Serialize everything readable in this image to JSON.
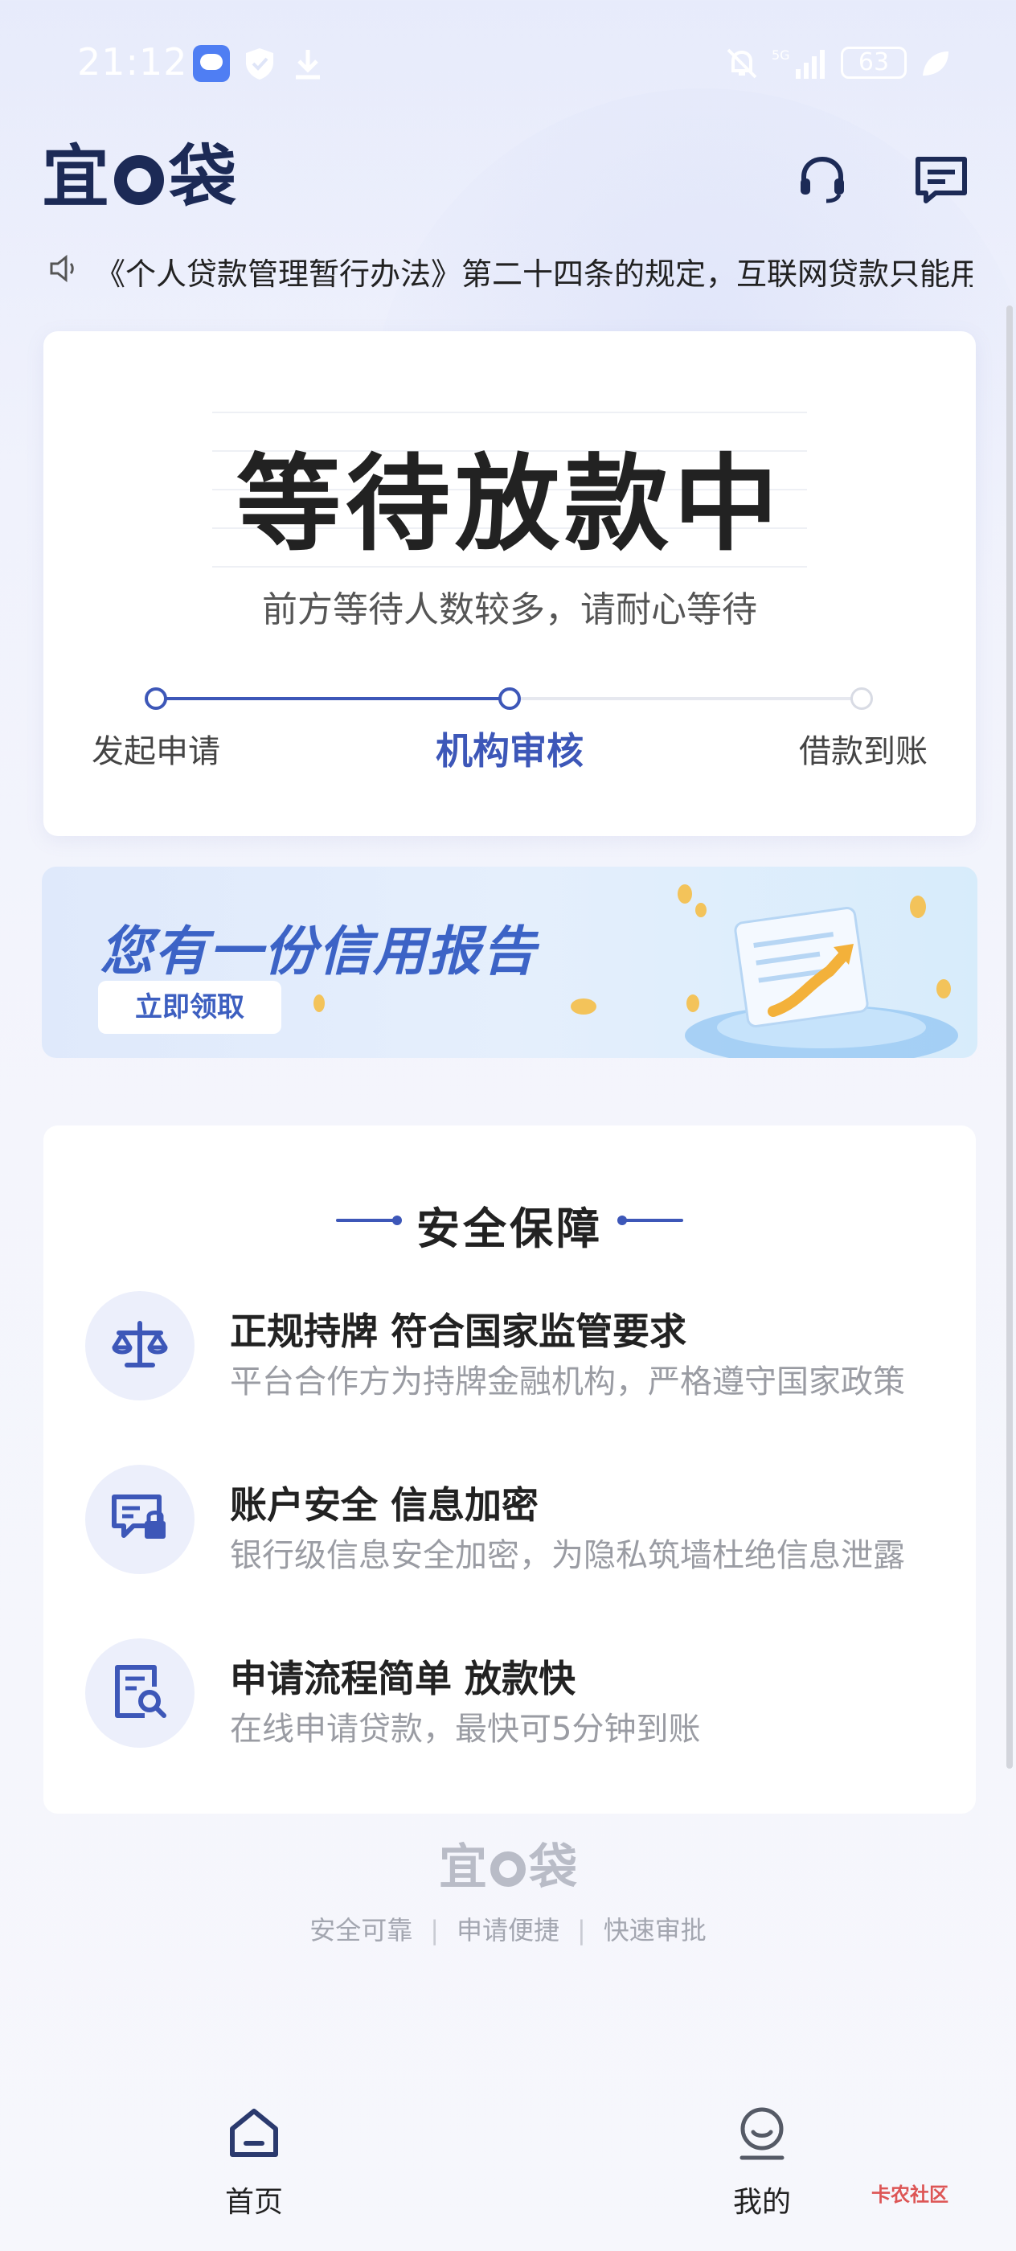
{
  "status_bar": {
    "time": "21:12",
    "battery": "63"
  },
  "header": {
    "logo_part1": "宜",
    "logo_part2": "袋",
    "service_icon": "headset-icon",
    "message_icon": "message-icon"
  },
  "notice": {
    "icon": "speaker-icon",
    "text": "《个人贷款管理暂行办法》第二十四条的规定，互联网贷款只能用于"
  },
  "status_card": {
    "title": "等待放款中",
    "subtitle": "前方等待人数较多，请耐心等待",
    "steps": [
      {
        "label": "发起申请",
        "state": "done"
      },
      {
        "label": "机构审核",
        "state": "current"
      },
      {
        "label": "借款到账",
        "state": "pending"
      }
    ],
    "accent_color": "#3d57b8"
  },
  "banner": {
    "title": "您有一份信用报告",
    "button": "立即领取"
  },
  "security": {
    "title": "安全保障",
    "features": [
      {
        "icon": "scale-icon",
        "title": "正规持牌 符合国家监管要求",
        "desc": "平台合作方为持牌金融机构，严格遵守国家政策"
      },
      {
        "icon": "secure-chat-icon",
        "title": "账户安全 信息加密",
        "desc": "银行级信息安全加密，为隐私筑墙杜绝信息泄露"
      },
      {
        "icon": "document-search-icon",
        "title": "申请流程简单 放款快",
        "desc": "在线申请贷款，最快可5分钟到账"
      }
    ]
  },
  "footer": {
    "logo_part1": "宜",
    "logo_part2": "袋",
    "slogans": [
      "安全可靠",
      "申请便捷",
      "快速审批"
    ]
  },
  "tabbar": {
    "home": "首页",
    "mine": "我的"
  },
  "watermark": "卡农社区"
}
